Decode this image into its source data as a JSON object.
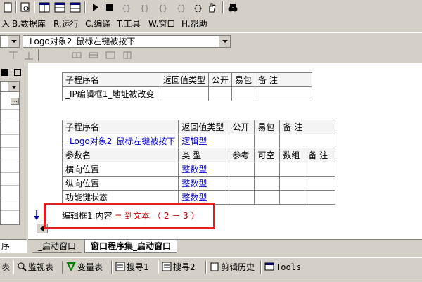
{
  "menu": {
    "items": [
      {
        "key": "A",
        "label": "入"
      },
      {
        "key": "B",
        "label": "B.数据库"
      },
      {
        "key": "R",
        "label": "R.运行"
      },
      {
        "key": "C",
        "label": "C.编译"
      },
      {
        "key": "T",
        "label": "T.工具"
      },
      {
        "key": "W",
        "label": "W.窗口"
      },
      {
        "key": "H",
        "label": "H.帮助"
      }
    ]
  },
  "toolbar2": {
    "combo_left_value": "",
    "combo_main_value": "_Logo对象2_鼠标左键被按下"
  },
  "table1": {
    "headers": [
      "子程序名",
      "返回值类型",
      "公开",
      "易包",
      "备 注"
    ],
    "row": [
      "_IP编辑框1_地址被改变",
      "",
      "",
      "",
      ""
    ]
  },
  "table2": {
    "headers": [
      "子程序名",
      "返回值类型",
      "公开",
      "易包",
      "备 注"
    ],
    "row": [
      "_Logo对象2_鼠标左键被按下",
      "逻辑型",
      "",
      "",
      ""
    ],
    "param_headers": [
      "参数名",
      "类 型",
      "参考",
      "可空",
      "数组",
      "备 注"
    ],
    "params": [
      [
        "横向位置",
        "整数型",
        "",
        "",
        "",
        ""
      ],
      [
        "纵向位置",
        "整数型",
        "",
        "",
        "",
        ""
      ],
      [
        "功能键状态",
        "整数型",
        "",
        "",
        "",
        ""
      ]
    ]
  },
  "code": {
    "target": "编辑框1.内容",
    "op": "=",
    "func": "到文本",
    "args": "（ 2 － 3 ）"
  },
  "tabs": [
    {
      "label": "_启动窗口",
      "active": false
    },
    {
      "label": "窗口程序集_启动窗口",
      "active": true
    }
  ],
  "left_panel": {
    "bottom_label": "序"
  },
  "bottom_bar": {
    "items": [
      {
        "label": "表",
        "icon": "table-icon"
      },
      {
        "label": "监视表",
        "icon": "magnifier-icon"
      },
      {
        "label": "变量表",
        "icon": "variables-icon"
      },
      {
        "label": "搜寻1",
        "icon": "search1-icon"
      },
      {
        "label": "搜寻2",
        "icon": "search2-icon"
      },
      {
        "label": "剪辑历史",
        "icon": "clipboard-icon"
      },
      {
        "label": "Tools",
        "icon": "tools-icon"
      }
    ]
  },
  "colors": {
    "background": "#d4d0c8",
    "highlight_box": "#e02020",
    "type_text": "#0000c0",
    "call_text": "#c00000"
  }
}
